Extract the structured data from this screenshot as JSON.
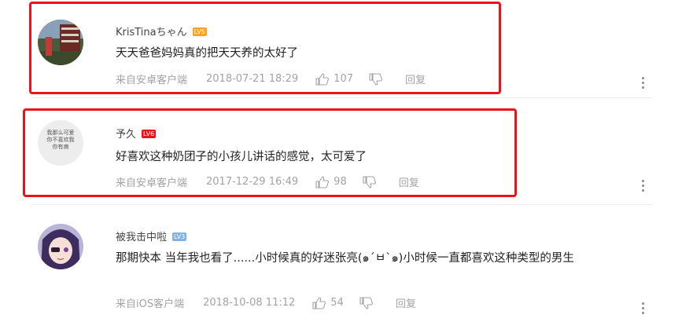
{
  "comments": [
    {
      "username": "KrisTinaちゃん",
      "level": "LV5",
      "text": "天天爸爸妈妈真的把天天养的太好了",
      "source": "来自安卓客户端",
      "time": "2018-07-21 18:29",
      "likes": "107",
      "reply": "回复"
    },
    {
      "username": "予久",
      "level": "LV6",
      "text": "好喜欢这种奶团子的小孩儿讲话的感觉，太可爱了",
      "source": "来自安卓客户端",
      "time": "2017-12-29 16:49",
      "likes": "98",
      "reply": "回复",
      "avatar_text": "我那么可爱\n你不喜欢我\n你有病"
    },
    {
      "username": "被我击中啦",
      "level": "LV3",
      "text": "那期快本 当年我也看了......小时候真的好迷张亮(๑´ㅂ`๑)小时候一直都喜欢这种类型的男生",
      "source": "来自iOS客户端",
      "time": "2018-10-08 11:12",
      "likes": "54",
      "reply": "回复"
    }
  ],
  "colors": {
    "highlight": "#e8141a",
    "badge_lv5": "#f5a623",
    "badge_lv6": "#e8141a",
    "badge_lv3": "#7fb2e5"
  }
}
